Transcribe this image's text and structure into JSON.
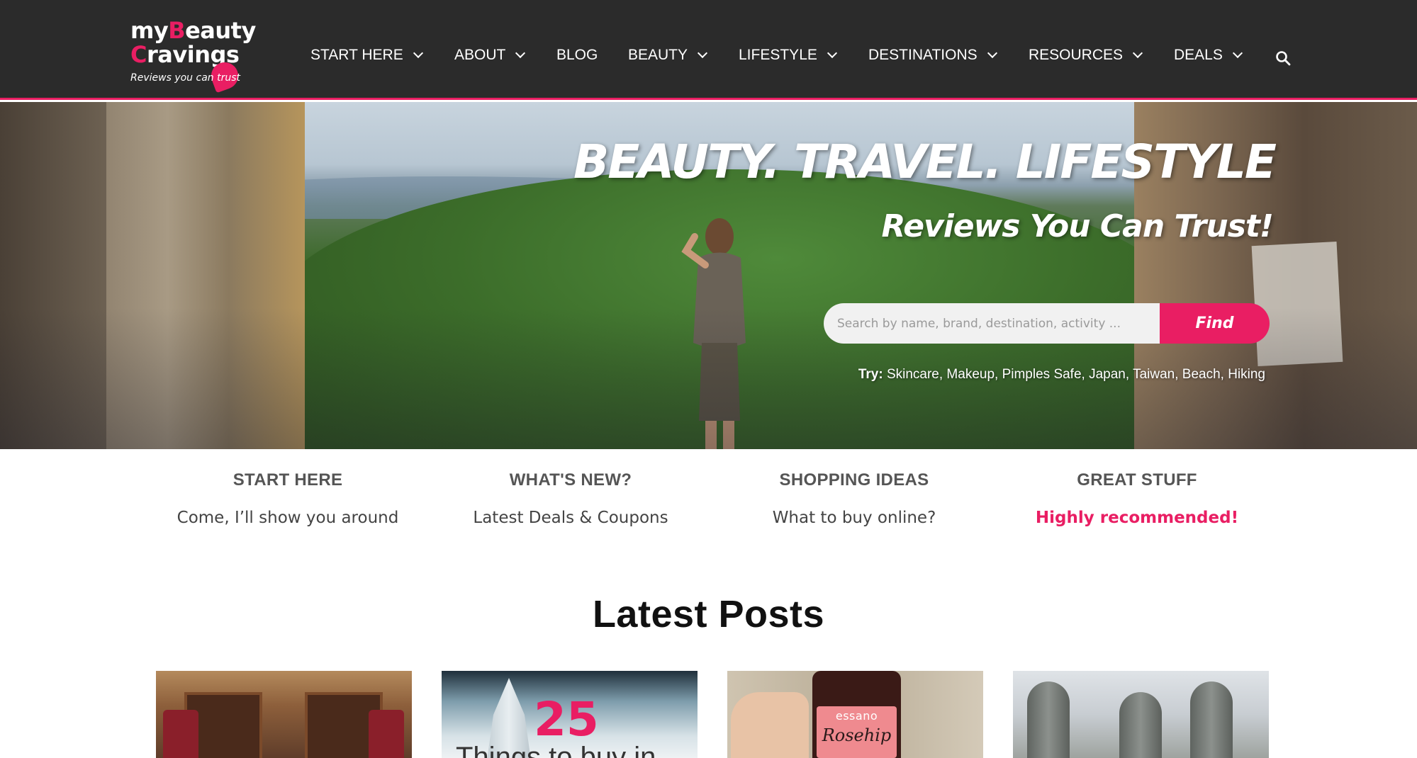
{
  "logo": {
    "line1_a": "my",
    "line1_b": "B",
    "line1_c": "eauty",
    "line2_a": "C",
    "line2_b": "ravings",
    "tagline_a": "Reviews you can ",
    "tagline_b": "trust"
  },
  "nav": {
    "items": [
      {
        "label": "START HERE",
        "dropdown": true
      },
      {
        "label": "ABOUT",
        "dropdown": true
      },
      {
        "label": "BLOG",
        "dropdown": false
      },
      {
        "label": "BEAUTY",
        "dropdown": true
      },
      {
        "label": "LIFESTYLE",
        "dropdown": true
      },
      {
        "label": "DESTINATIONS",
        "dropdown": true
      },
      {
        "label": "RESOURCES",
        "dropdown": true
      },
      {
        "label": "DEALS",
        "dropdown": true
      }
    ],
    "search_icon": "search-icon"
  },
  "hero": {
    "title": "BEAUTY. TRAVEL. LIFESTYLE",
    "subtitle": "Reviews You Can Trust!",
    "search_placeholder": "Search by name, brand, destination, activity ...",
    "find_label": "Find",
    "try_label": "Try:",
    "try_items": "Skincare, Makeup, Pimples Safe, Japan, Taiwan, Beach, Hiking"
  },
  "quick": [
    {
      "title": "START HERE",
      "link": "Come, I’ll show you around",
      "highlight": false
    },
    {
      "title": "WHAT'S NEW?",
      "link": "Latest Deals & Coupons",
      "highlight": false
    },
    {
      "title": "SHOPPING IDEAS",
      "link": "What to buy online?",
      "highlight": false
    },
    {
      "title": "GREAT STUFF",
      "link": "Highly recommended!",
      "highlight": true
    }
  ],
  "latest": {
    "title": "Latest Posts",
    "post2_number": "25",
    "post2_text": "Things to buy in",
    "post3_brand": "essano",
    "post3_product": "Rosehip"
  },
  "colors": {
    "accent": "#e91e63",
    "header_bg": "#2b2b2b"
  }
}
